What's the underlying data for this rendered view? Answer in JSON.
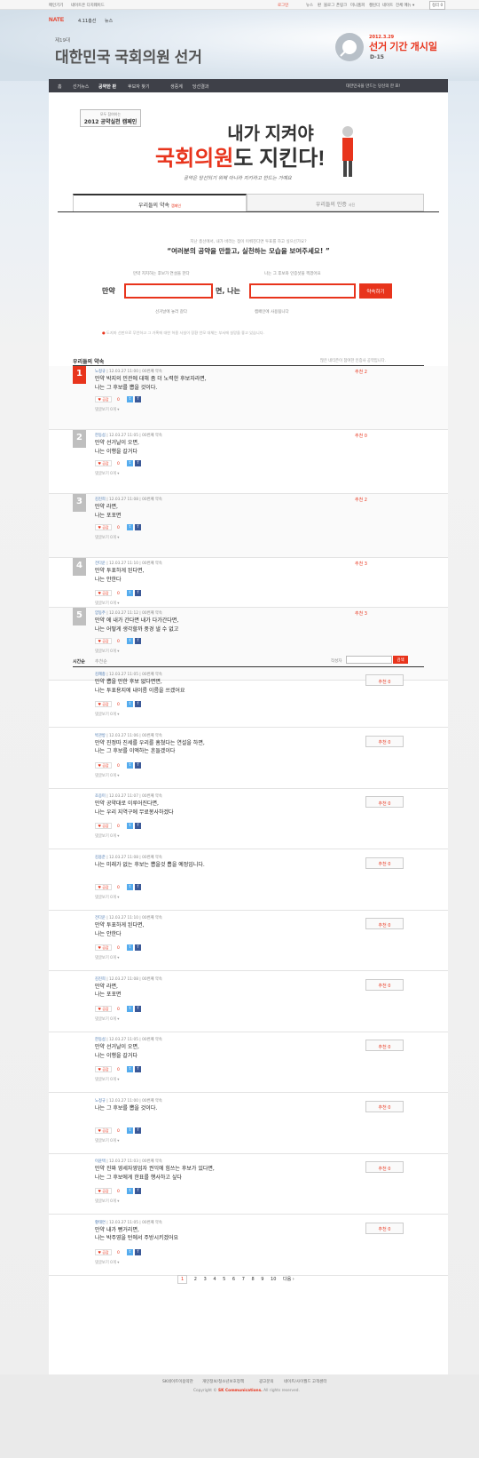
{
  "topbar": {
    "links": [
      "메인기기",
      "네이트온 디지웨이드"
    ],
    "right": [
      "로그인",
      "뉴스",
      "판",
      "블로그",
      "폰링크",
      "미니홈피",
      "캘린더",
      "네이트",
      "전체 메뉴 ▾",
      "정리 0"
    ]
  },
  "header": {
    "logo": "NATE",
    "logo_sub": "4.11총선",
    "logo_news": "뉴스",
    "edition": "제19대",
    "title": "대한민국 국회의원 선거",
    "dday_date": "2012.3.29",
    "dday_title": "선거 기간 개시일",
    "dday_count": "D-15"
  },
  "nav": {
    "items": [
      "홈",
      "선거뉴스",
      "공약한 판",
      "후보자 찾기",
      "생중계",
      "당선결과"
    ],
    "right": "대한민국을 만드는 당신의 한 표!"
  },
  "hero": {
    "badge_top": "모두 참여하는",
    "badge_main": "2012 공약실천 캠페인",
    "line1": "내가 지켜야",
    "line2_red": "국회의원",
    "line2_rest": "도 지킨다!",
    "sub": "공약은 당선되기 위해 아니라 지키라고 만드는 거예요"
  },
  "tabs": [
    {
      "label": "우리들의 약속",
      "badge": "캠페인"
    },
    {
      "label": "우리들의 인증",
      "badge": "사진"
    }
  ],
  "intro": {
    "small": "지난 총선에서, 내가 바라는 점이 이뤄진다면 투표를 하고 싶으신가요?",
    "big": "“여러분의 공약을 만들고, 실천하는 모습을 보여주세요! ”"
  },
  "form": {
    "label_left": "만약",
    "label_mid": "면, 나는",
    "hint_left": "만약 지지하는 후보가 연설을 한다",
    "hint_right": "나는 그 후보와 인증샷을 찍겠어요",
    "caption_left": "선거날에 놓러 갈다",
    "caption_right": "캠페인에 사용됩니다",
    "submit": "약속하기",
    "notice": "도지마 선판으로 무언하고 그 가혹에 대한 허용 사실이 장환 언모 대체는 부서에 실망을 좋고 있습니다."
  },
  "best": {
    "title": "우리들의 약속",
    "note": "많은 네티즌이 참여한 인증사 공약입니다.",
    "share_label": "공감",
    "reply_label": "댓글보기",
    "entries": [
      {
        "rank": "1",
        "author": "노정규",
        "date": "12.03.27 11:00",
        "meta": "00번째 약속",
        "lines": [
          "만약 박지의 민관에 대해 좀 더 노력한 후보자라면,",
          "나는 그 후보를 뽑을 것이다."
        ],
        "rec": "추천 2",
        "replies": "0"
      },
      {
        "rank": "2",
        "author": "한동섭",
        "date": "12.03.27 11:05",
        "meta": "00번째 약속",
        "lines": [
          "만약 선거날이 오면,",
          "나는 이행을 갈거다"
        ],
        "rec": "추천 0",
        "replies": "0"
      },
      {
        "rank": "3",
        "author": "김진희",
        "date": "12.03.27 11:08",
        "meta": "00번째 약속",
        "lines": [
          "만약 라면,",
          "나는 포포면"
        ],
        "rec": "추천 2",
        "replies": "0"
      },
      {
        "rank": "4",
        "author": "전다운",
        "date": "12.03.27 11:10",
        "meta": "00번째 약속",
        "lines": [
          "만약 투표하게 된다면,",
          "나는 안한다"
        ],
        "rec": "추천 3",
        "replies": "0"
      },
      {
        "rank": "5",
        "author": "양동주",
        "date": "12.03.27 11:12",
        "meta": "00번째 약속",
        "lines": [
          "만약 에 내가 간다면 내가 다가간다면,",
          "나는 어떻게 생각할까 풍경 낼 수 없고"
        ],
        "rec": "추천 3",
        "replies": "0"
      }
    ]
  },
  "list": {
    "sort": [
      "시간순",
      "추천순"
    ],
    "search_label": "작성자",
    "search_button": "검색",
    "entries": [
      {
        "author": "김혜충",
        "date": "12.03.27 11:05",
        "meta": "00번째 약속",
        "lines": [
          "만약 뽑을 만한 후보 없다면면,",
          "나는 투표용지에 내이름 이름을 쓰겠어요"
        ],
        "rec": "추천 0"
      },
      {
        "author": "박관방",
        "date": "12.03.27 11:06",
        "meta": "00번째 약속",
        "lines": [
          "만약 진정따 진세를 우리를 흠쳤다는 연설을 하면,",
          "나는 그 후보를 이엑하는 흔들겠이다"
        ],
        "rec": "추천 0"
      },
      {
        "author": "조응미",
        "date": "12.03.27 11:07",
        "meta": "00번째 약속",
        "lines": [
          "만약 공약대로 이루어진다면,",
          "나는 우리 지역구에 무료봉사하겠다"
        ],
        "rec": "추천 0"
      },
      {
        "author": "김용준",
        "date": "12.03.27 11:08",
        "meta": "00번째 약속",
        "lines": [
          "나는 미래가 없는 후보는 뽑을것 뽑을 예정입니다."
        ],
        "rec": "추천 0"
      },
      {
        "author": "전다운",
        "date": "12.03.27 11:10",
        "meta": "00번째 약속",
        "lines": [
          "만약 투표하게 된다면,",
          "나는 안한다"
        ],
        "rec": "추천 0"
      },
      {
        "author": "김진희",
        "date": "12.03.27 11:08",
        "meta": "00번째 약속",
        "lines": [
          "만약 라면,",
          "나는 포포면"
        ],
        "rec": "추천 0"
      },
      {
        "author": "한동섭",
        "date": "12.03.27 11:05",
        "meta": "00번째 약속",
        "lines": [
          "만약 선거날이 오면,",
          "나는 이행을 갈거다"
        ],
        "rec": "추천 0"
      },
      {
        "author": "노정규",
        "date": "12.03.27 11:00",
        "meta": "00번째 약속",
        "lines": [
          "나는 그 후보를 뽑을 것이다."
        ],
        "rec": "추천 0"
      },
      {
        "author": "이윤택",
        "date": "12.03.27 11:03",
        "meta": "00번째 약속",
        "lines": [
          "만약 진짜 영세자영업자 권익에 힘쓰는 후보가 있다면,",
          "나는 그 후보에게 한표를 행사하고 싶다"
        ],
        "rec": "추천 0"
      },
      {
        "author": "황태연",
        "date": "12.03.27 11:05",
        "meta": "00번째 약속",
        "lines": [
          "만약 내가 뻥거리면,",
          "나는 박주영을 턴에서 주방시키겠어요"
        ],
        "rec": "추천 0"
      }
    ]
  },
  "pagination": {
    "pages": [
      "1",
      "2",
      "3",
      "4",
      "5",
      "6",
      "7",
      "8",
      "9",
      "10"
    ],
    "next": "다음 ›"
  },
  "footer": {
    "links": [
      "SK네이트이용약관",
      "개인정보/청소년보호정책",
      "광고문의",
      "네이트/사이월드 고객센터"
    ],
    "copy_pre": "Copyright ©",
    "copy_brand": "SK Communications.",
    "copy_post": "All rights reserved."
  },
  "colors": {
    "accent": "#e8341c",
    "nav": "#3e4048",
    "twitter": "#55acee",
    "facebook": "#3b5998"
  }
}
